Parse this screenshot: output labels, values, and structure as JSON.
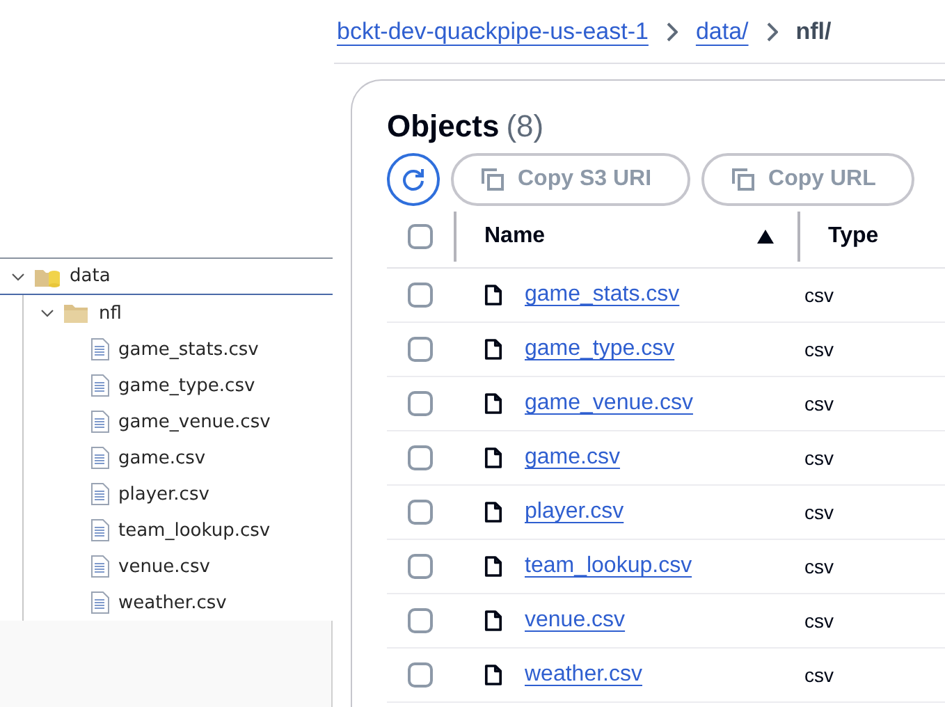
{
  "tree": [
    {
      "label": "data",
      "expanded": true,
      "selected": true,
      "kind": "bucket-folder",
      "children": [
        {
          "label": "nfl",
          "expanded": true,
          "selected": false,
          "kind": "folder",
          "children": [
            {
              "label": "game_stats.csv",
              "kind": "file"
            },
            {
              "label": "game_type.csv",
              "kind": "file"
            },
            {
              "label": "game_venue.csv",
              "kind": "file"
            },
            {
              "label": "game.csv",
              "kind": "file"
            },
            {
              "label": "player.csv",
              "kind": "file"
            },
            {
              "label": "team_lookup.csv",
              "kind": "file"
            },
            {
              "label": "venue.csv",
              "kind": "file"
            },
            {
              "label": "weather.csv",
              "kind": "file"
            }
          ]
        }
      ]
    }
  ],
  "breadcrumb": [
    {
      "label": "bckt-dev-quackpipe-us-east-1",
      "link": true
    },
    {
      "label": "data/",
      "link": true
    },
    {
      "label": "nfl/",
      "link": false
    }
  ],
  "panel": {
    "title": "Objects",
    "count": "(8)",
    "buttons": [
      "Copy S3 URI",
      "Copy URL"
    ],
    "columns": [
      {
        "label": "Name",
        "sorted": true
      },
      {
        "label": "Type",
        "sorted": false
      }
    ],
    "select_all_checked": false,
    "rows": [
      {
        "name": "game_stats.csv",
        "type": "csv",
        "checked": false
      },
      {
        "name": "game_type.csv",
        "type": "csv",
        "checked": false
      },
      {
        "name": "game_venue.csv",
        "type": "csv",
        "checked": false
      },
      {
        "name": "game.csv",
        "type": "csv",
        "checked": false
      },
      {
        "name": "player.csv",
        "type": "csv",
        "checked": false
      },
      {
        "name": "team_lookup.csv",
        "type": "csv",
        "checked": false
      },
      {
        "name": "venue.csv",
        "type": "csv",
        "checked": false
      },
      {
        "name": "weather.csv",
        "type": "csv",
        "checked": false
      }
    ]
  }
}
